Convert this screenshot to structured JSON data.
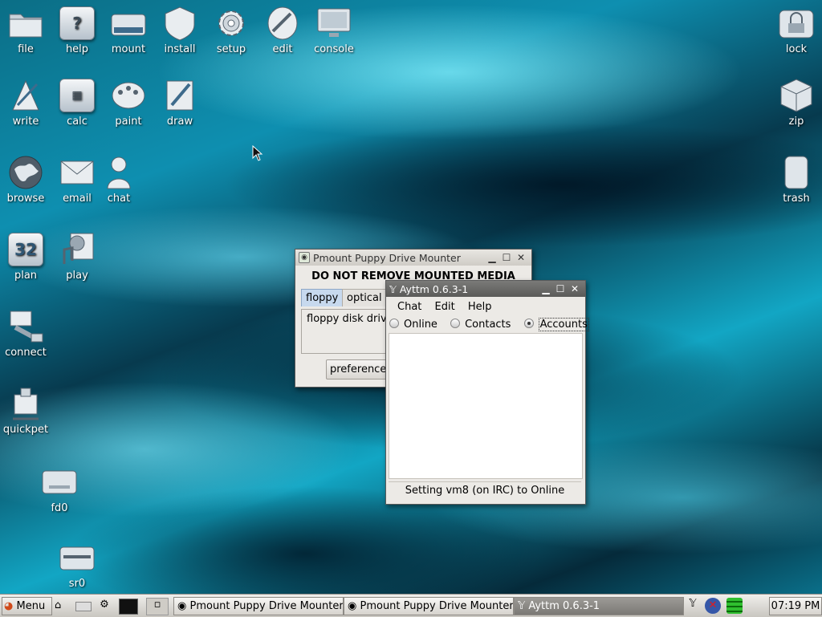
{
  "desktop": {
    "icons": [
      {
        "label": "file",
        "icon": "folder-icon"
      },
      {
        "label": "help",
        "icon": "help-icon"
      },
      {
        "label": "mount",
        "icon": "drive-icon"
      },
      {
        "label": "install",
        "icon": "shield-icon"
      },
      {
        "label": "setup",
        "icon": "gear-icon"
      },
      {
        "label": "edit",
        "icon": "edit-icon"
      },
      {
        "label": "console",
        "icon": "monitor-icon"
      },
      {
        "label": "lock",
        "icon": "lock-icon"
      },
      {
        "label": "write",
        "icon": "write-icon"
      },
      {
        "label": "calc",
        "icon": "calculator-icon"
      },
      {
        "label": "paint",
        "icon": "palette-icon"
      },
      {
        "label": "draw",
        "icon": "pen-icon"
      },
      {
        "label": "zip",
        "icon": "box-icon"
      },
      {
        "label": "browse",
        "icon": "globe-icon"
      },
      {
        "label": "email",
        "icon": "envelope-icon"
      },
      {
        "label": "chat",
        "icon": "people-icon"
      },
      {
        "label": "trash",
        "icon": "trash-icon"
      },
      {
        "label": "plan",
        "icon": "calendar-icon"
      },
      {
        "label": "play",
        "icon": "media-icon"
      },
      {
        "label": "connect",
        "icon": "network-icon"
      },
      {
        "label": "quickpet",
        "icon": "pet-icon"
      },
      {
        "label": "fd0",
        "icon": "floppy-drive-icon"
      },
      {
        "label": "sr0",
        "icon": "optical-drive-icon"
      }
    ],
    "calendar_day": "32"
  },
  "pmount": {
    "title": "Pmount Puppy Drive Mounter",
    "warning": "DO NOT REMOVE MOUNTED MEDIA",
    "tabs": [
      "floppy",
      "optical"
    ],
    "drive_text": "floppy disk driv",
    "preferences_label": "preference"
  },
  "ayttm": {
    "title": "Ayttm 0.6.3-1",
    "menu": [
      "Chat",
      "Edit",
      "Help"
    ],
    "radios": [
      "Online",
      "Contacts",
      "Accounts"
    ],
    "status": "Setting vm8 (on IRC) to Online"
  },
  "taskbar": {
    "menu_label": "Menu",
    "tasks": [
      "Pmount Puppy Drive Mounter",
      "Pmount Puppy Drive Mounter",
      "Ayttm 0.6.3-1"
    ],
    "clock": "07:19 PM"
  }
}
